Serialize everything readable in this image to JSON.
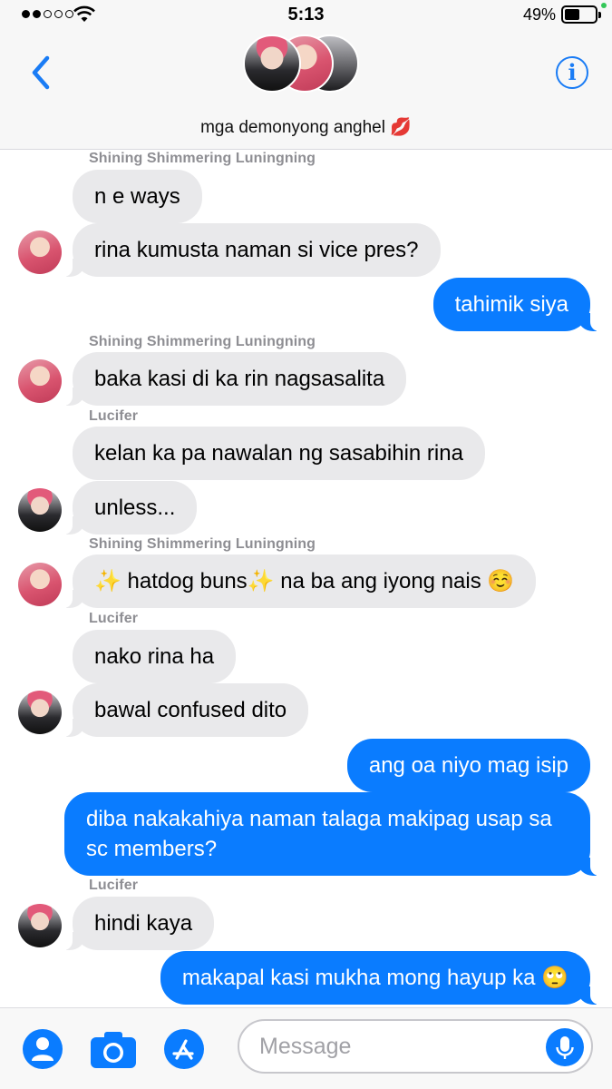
{
  "status_bar": {
    "time": "5:13",
    "battery_percent": "49%",
    "battery_level": 0.49,
    "signal_bars_filled": 2,
    "signal_bars_total": 5
  },
  "header": {
    "group_name": "mga demonyong anghel 💋",
    "info_label": "i"
  },
  "messages": [
    {
      "sender": "Shining Shimmering Luningning"
    },
    {
      "text": "n e ways",
      "direction": "in"
    },
    {
      "text": "rina kumusta naman si vice pres?",
      "direction": "in"
    },
    {
      "text": "tahimik siya",
      "direction": "out"
    },
    {
      "sender": "Shining Shimmering Luningning"
    },
    {
      "text": "baka kasi di ka rin nagsasalita",
      "direction": "in"
    },
    {
      "sender": "Lucifer"
    },
    {
      "text": "kelan ka pa nawalan ng sasabihin rina",
      "direction": "in"
    },
    {
      "text": "unless...",
      "direction": "in"
    },
    {
      "sender": "Shining Shimmering Luningning"
    },
    {
      "text": "✨ hatdog buns✨  na ba ang iyong nais ☺️",
      "direction": "in"
    },
    {
      "sender": "Lucifer"
    },
    {
      "text": "nako rina ha",
      "direction": "in"
    },
    {
      "text": "bawal confused dito",
      "direction": "in"
    },
    {
      "text": "ang oa niyo mag isip",
      "direction": "out"
    },
    {
      "text": "diba nakakahiya naman talaga makipag usap sa sc members?",
      "direction": "out"
    },
    {
      "sender": "Lucifer"
    },
    {
      "text": "hindi kaya",
      "direction": "in"
    },
    {
      "text": "makapal kasi mukha mong hayup ka 🙄",
      "direction": "out"
    }
  ],
  "input_bar": {
    "placeholder": "Message",
    "value": ""
  },
  "colors": {
    "accent": "#0a7cff",
    "incoming_bubble": "#e9e9eb",
    "sender_label": "#8e8e93"
  }
}
